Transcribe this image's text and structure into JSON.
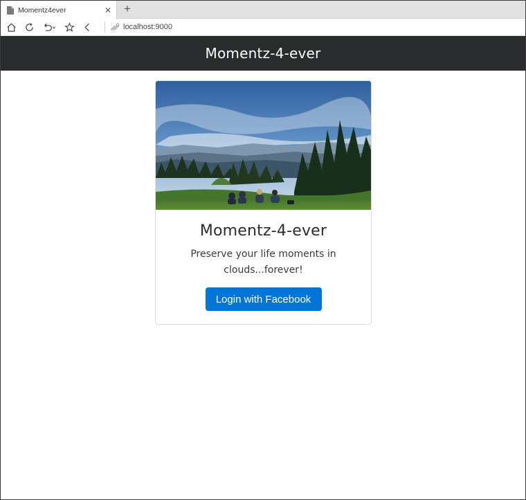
{
  "browser": {
    "tab": {
      "title": "Momentz4ever",
      "close_glyph": "✕",
      "icon": "document-icon"
    },
    "new_tab_glyph": "+",
    "toolbar": {
      "icons": [
        "home-icon",
        "refresh-icon",
        "undo-icon",
        "favorite-star-icon",
        "back-icon"
      ],
      "address": "localhost:9000",
      "site_icon": "loading-site-icon"
    }
  },
  "navbar": {
    "brand": "Momentz-4-ever",
    "background": "#292b2c"
  },
  "card": {
    "title": "Momentz-4-ever",
    "text": "Preserve your life moments in clouds...forever!",
    "button_label": "Login with Facebook",
    "button_color": "#0275d8",
    "image": "landscape-photo"
  }
}
